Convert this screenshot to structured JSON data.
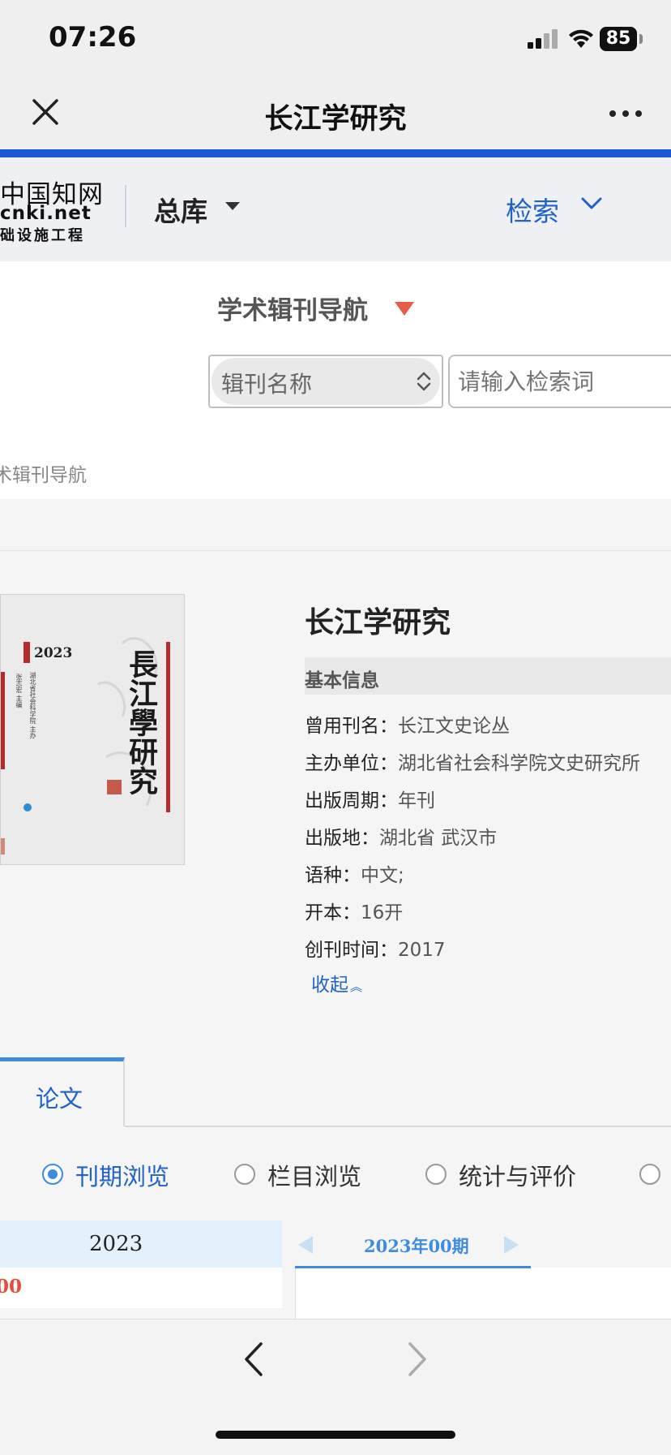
{
  "status_bar": {
    "time": "07:26",
    "battery": "85"
  },
  "nav_bar": {
    "title": "长江学研究"
  },
  "cnki_header": {
    "logo_line1": "中国知网",
    "logo_line2": "cnki.net",
    "logo_line3": "础设施工程",
    "library": "总库",
    "search_link": "检索"
  },
  "search_panel": {
    "nav_title": "学术辑刊导航",
    "select_value": "辑刊名称",
    "input_placeholder": "请输入检索词"
  },
  "breadcrumb": "术辑刊导航",
  "cover": {
    "year": "2023",
    "calligraphy": "長江學研究",
    "sponsor": "湖北省社会科学院 主办",
    "editor": "张志宏 主编"
  },
  "journal": {
    "title": "长江学研究",
    "basic_info": "基本信息",
    "fields": [
      {
        "label": "曾用刊名：",
        "value": "长江文史论丛"
      },
      {
        "label": "主办单位：",
        "value": "湖北省社会科学院文史研究所"
      },
      {
        "label": "出版周期：",
        "value": "年刊"
      },
      {
        "label": "出版地：",
        "value": "湖北省 武汉市"
      },
      {
        "label": "语种：",
        "value": "中文;"
      },
      {
        "label": "开本：",
        "value": "16开"
      },
      {
        "label": "创刊时间：",
        "value": "2017"
      }
    ],
    "collapse": "收起"
  },
  "tabs": {
    "active": "论文"
  },
  "browse_options": [
    {
      "label": "刊期浏览",
      "selected": true
    },
    {
      "label": "栏目浏览",
      "selected": false
    },
    {
      "label": "统计与评价",
      "selected": false
    },
    {
      "label": "",
      "selected": false
    }
  ],
  "issues": {
    "year": "2023",
    "year_count": "00",
    "current_issue": "2023年00期"
  },
  "colors": {
    "accent": "#1a58d6",
    "link": "#1f63c6",
    "highlight": "#e84b3c"
  }
}
